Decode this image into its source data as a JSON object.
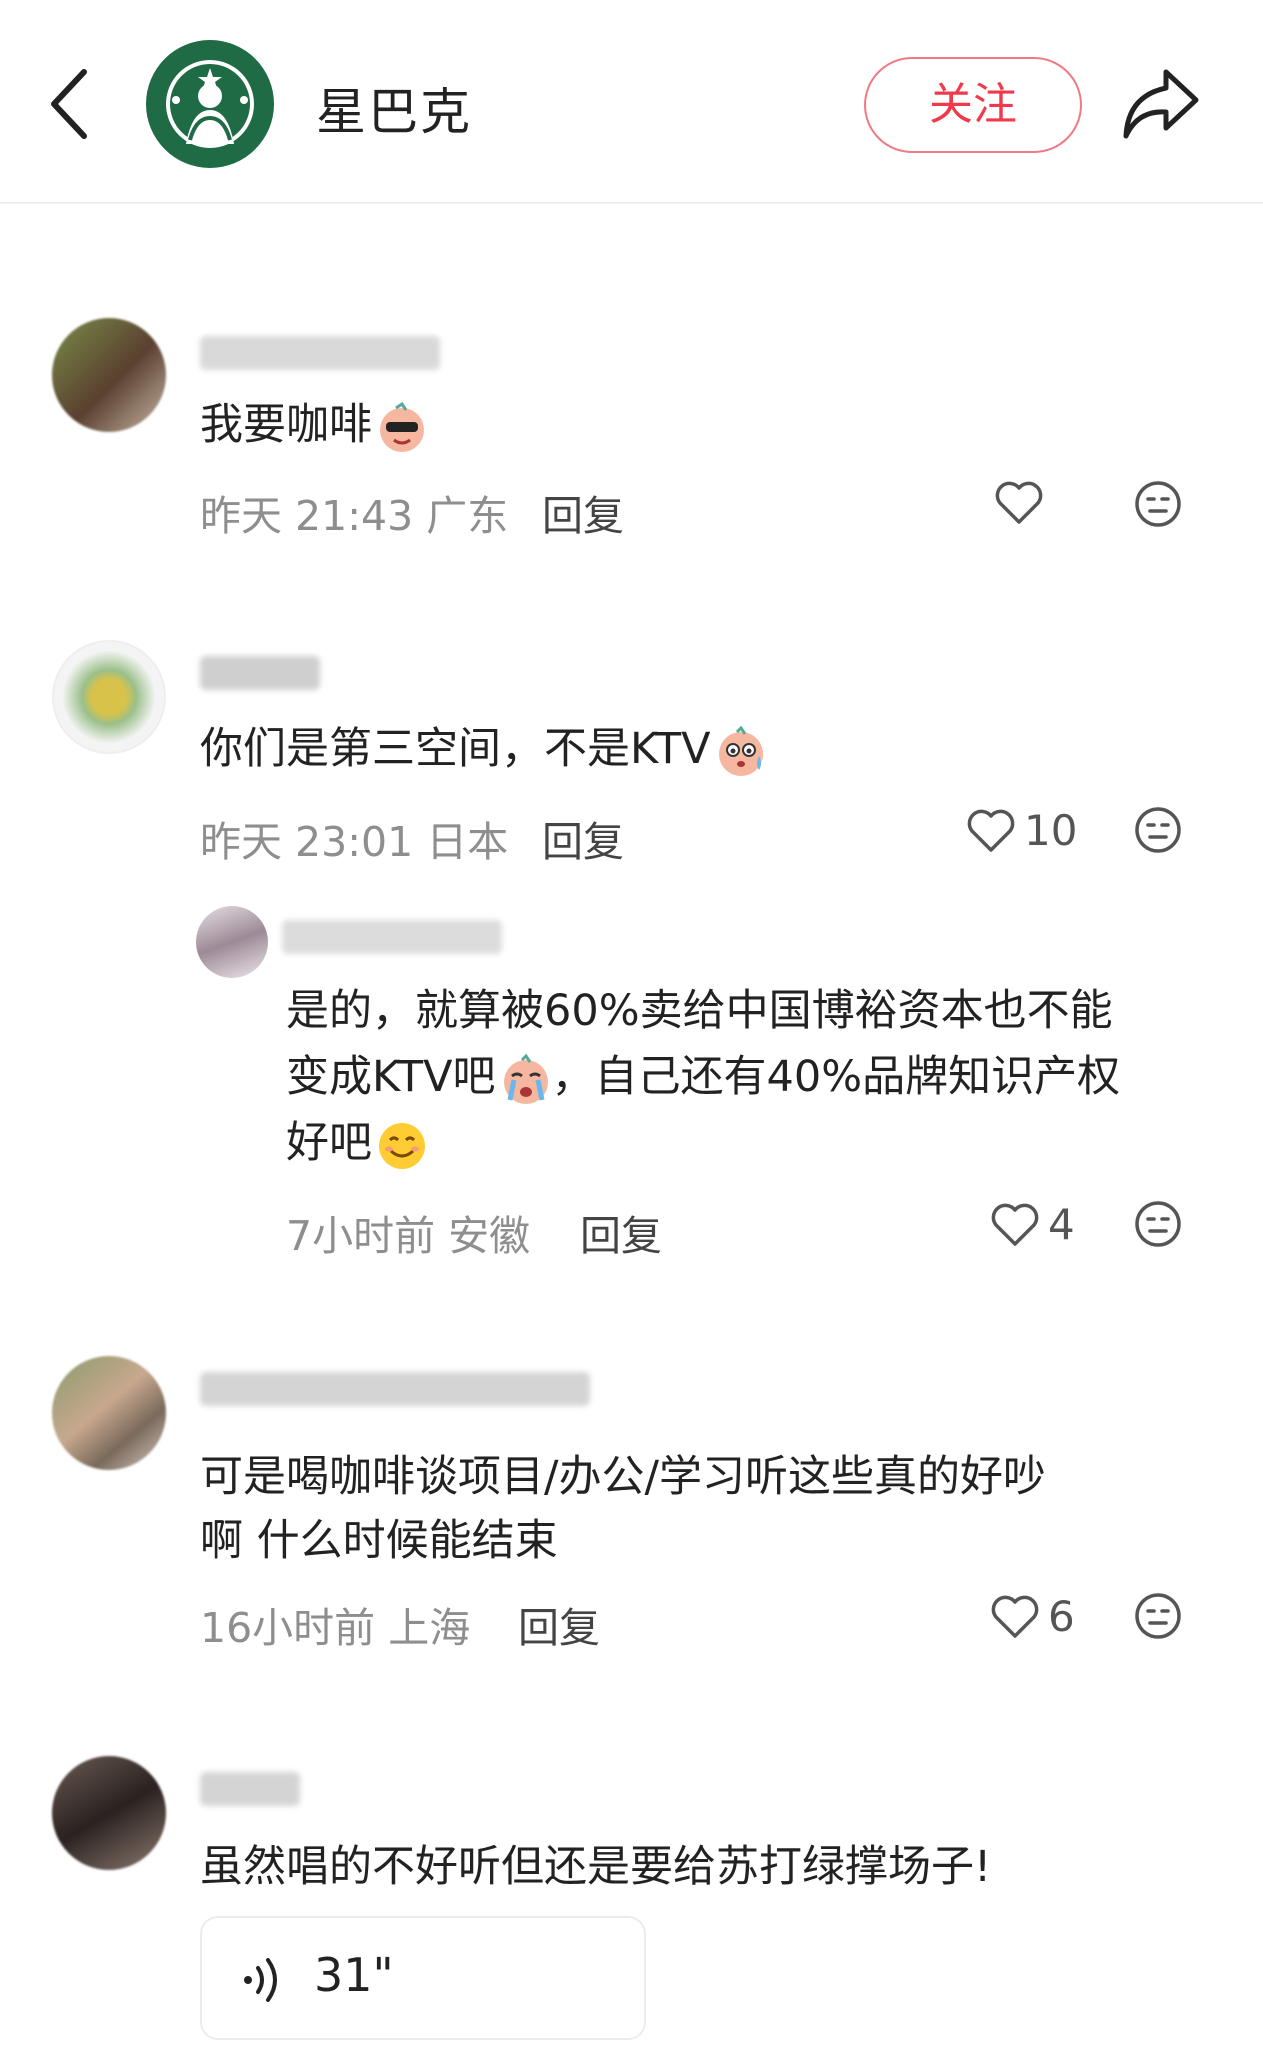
{
  "header": {
    "account_name": "星巴克",
    "follow_label": "关注",
    "icons": [
      "back-arrow-icon",
      "starbucks-logo",
      "share-icon"
    ]
  },
  "comments": [
    {
      "text": "我要咖啡",
      "time": "昨天 21:43",
      "location": "广东",
      "reply_label": "回复",
      "likes": ""
    },
    {
      "text": "你们是第三空间，不是KTV",
      "time": "昨天 23:01",
      "location": "日本",
      "reply_label": "回复",
      "likes": "10"
    },
    {
      "is_reply": true,
      "lines": [
        "是的，就算被60%卖给中国博裕资本也不能",
        "变成KTV吧",
        "，自己还有40%品牌知识产权",
        "好吧"
      ],
      "time": "7小时前",
      "location": "安徽",
      "reply_label": "回复",
      "likes": "4"
    },
    {
      "lines": [
        "可是喝咖啡谈项目/办公/学习听这些真的好吵",
        "啊 什么时候能结束"
      ],
      "time": "16小时前",
      "location": "上海",
      "reply_label": "回复",
      "likes": "6"
    },
    {
      "text": "虽然唱的不好听但还是要给苏打绿撑场子!",
      "voice_duration": "31\""
    }
  ],
  "colors": {
    "follow_border": "#f07a84",
    "follow_text": "#f03a4c",
    "meta_text": "#8e8e8e",
    "starbucks_green": "#1e6b45"
  }
}
